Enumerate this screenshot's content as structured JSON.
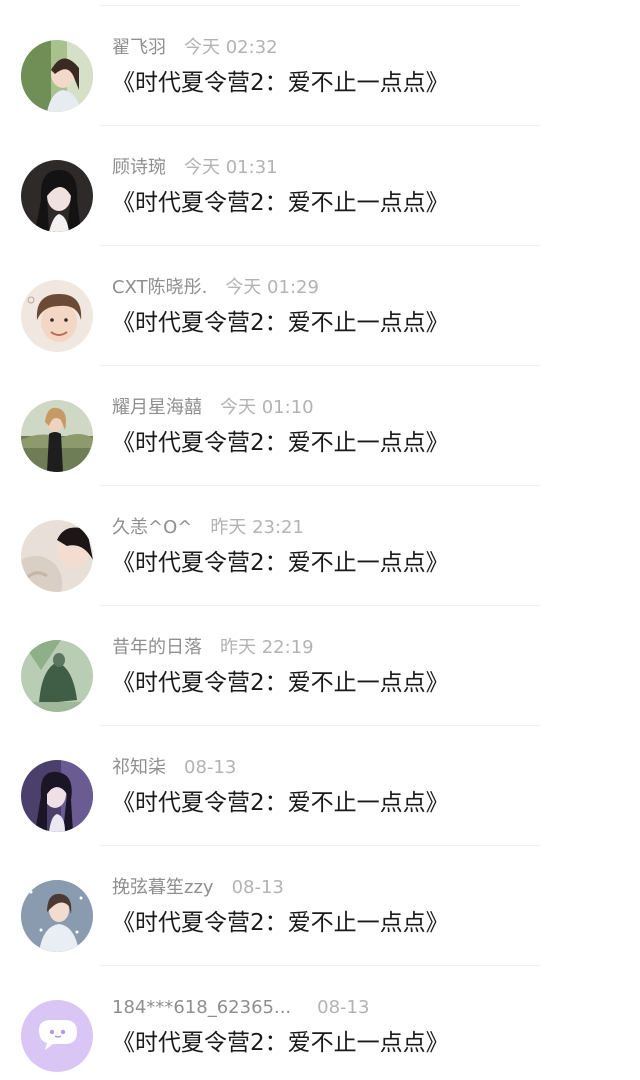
{
  "comments": [
    {
      "username": "翟飞羽",
      "time": "今天 02:32",
      "message": "《时代夏令营2：爱不止一点点》",
      "avatar": "photo-girl-outdoor"
    },
    {
      "username": "顾诗琬",
      "time": "今天 01:31",
      "message": "《时代夏令营2：爱不止一点点》",
      "avatar": "photo-girl-dark-hair"
    },
    {
      "username": "CXT陈晓彤.",
      "time": "今天 01:29",
      "message": "《时代夏令营2：爱不止一点点》",
      "avatar": "photo-boy-smiling"
    },
    {
      "username": "耀月星海囍",
      "time": "今天 01:10",
      "message": "《时代夏令营2：爱不止一点点》",
      "avatar": "photo-girl-landscape"
    },
    {
      "username": "久恙^O^",
      "time": "昨天 23:21",
      "message": "《时代夏令营2：爱不止一点点》",
      "avatar": "photo-girl-fur"
    },
    {
      "username": "昔年的日落",
      "time": "昨天 22:19",
      "message": "《时代夏令营2：爱不止一点点》",
      "avatar": "photo-green-figure"
    },
    {
      "username": "祁知柒",
      "time": "08-13",
      "message": "《时代夏令营2：爱不止一点点》",
      "avatar": "photo-girl-purple"
    },
    {
      "username": "挽弦暮笙zzy",
      "time": "08-13",
      "message": "《时代夏令营2：爱不止一点点》",
      "avatar": "photo-girl-snow"
    },
    {
      "username": "184***618_62365...",
      "time": "08-13",
      "message": "《时代夏令营2：爱不止一点点》",
      "avatar": "default-chat-bubble-icon"
    }
  ],
  "colors": {
    "username": "#8f8f8f",
    "time": "#b3b3b3",
    "message": "#1a1a1a",
    "default_avatar_bg": "#d9c6f5"
  }
}
